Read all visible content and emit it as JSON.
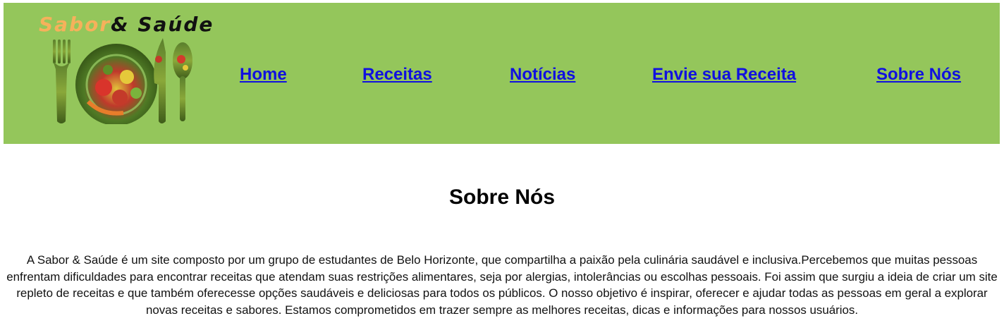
{
  "header": {
    "logo": {
      "brand_part1": "Sabor",
      "brand_part2": "& Saúde",
      "icon": "plate-with-vegetables-fork-knife-icon"
    },
    "nav": [
      {
        "label": "Home"
      },
      {
        "label": "Receitas"
      },
      {
        "label": "Notícias"
      },
      {
        "label": "Envie sua Receita"
      },
      {
        "label": "Sobre Nós"
      }
    ]
  },
  "main": {
    "title": "Sobre Nós",
    "paragraph": "A Sabor & Saúde é um site composto por um grupo de estudantes de Belo Horizonte, que compartilha a paixão pela culinária saudável e inclusiva.Percebemos que muitas pessoas enfrentam dificuldades para encontrar receitas que atendam suas restrições alimentares, seja por alergias, intolerâncias ou escolhas pessoais. Foi assim que surgiu a ideia de criar um site repleto de receitas e que também oferecesse opções saudáveis e deliciosas para todos os públicos. O nosso objetivo é inspirar, oferecer e ajudar todas as pessoas em geral a explorar novas receitas e sabores. Estamos comprometidos em trazer sempre as melhores receitas, dicas e informações para nossos usuários."
  },
  "colors": {
    "header_bg": "#94c65b",
    "link": "#1010e0",
    "brand_orange": "#f6b15b"
  }
}
